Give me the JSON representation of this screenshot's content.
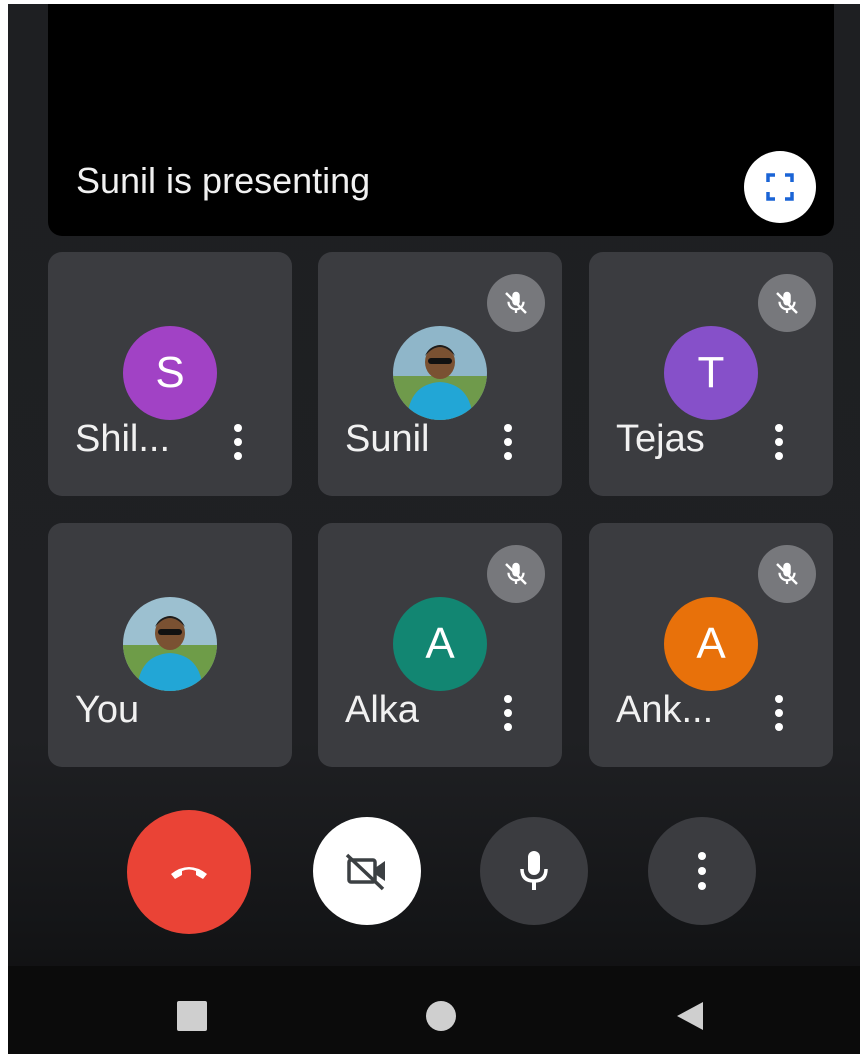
{
  "presentation": {
    "label": "Sunil is presenting",
    "fullscreen_icon": "fullscreen-icon"
  },
  "participants": [
    {
      "name": "Shil...",
      "avatar_type": "initial",
      "initial": "S",
      "avatar_color": "#a142c5",
      "muted": false,
      "has_menu": true
    },
    {
      "name": "Sunil",
      "avatar_type": "photo",
      "muted": true,
      "has_menu": true
    },
    {
      "name": "Tejas",
      "avatar_type": "initial",
      "initial": "T",
      "avatar_color": "#8650c9",
      "muted": true,
      "has_menu": true
    },
    {
      "name": "You",
      "avatar_type": "photo",
      "muted": false,
      "has_menu": false
    },
    {
      "name": "Alka",
      "avatar_type": "initial",
      "initial": "A",
      "avatar_color": "#128672",
      "muted": true,
      "has_menu": true
    },
    {
      "name": "Ank...",
      "avatar_type": "initial",
      "initial": "A",
      "avatar_color": "#e8710a",
      "muted": true,
      "has_menu": true
    }
  ],
  "controls": {
    "end_call_icon": "end-call-icon",
    "camera_icon": "camera-off-icon",
    "mic_icon": "mic-icon",
    "more_icon": "more-vert-icon",
    "end_call_color": "#ea4336"
  },
  "system_nav": {
    "recents_icon": "square-recents-icon",
    "home_icon": "circle-home-icon",
    "back_icon": "triangle-back-icon"
  }
}
